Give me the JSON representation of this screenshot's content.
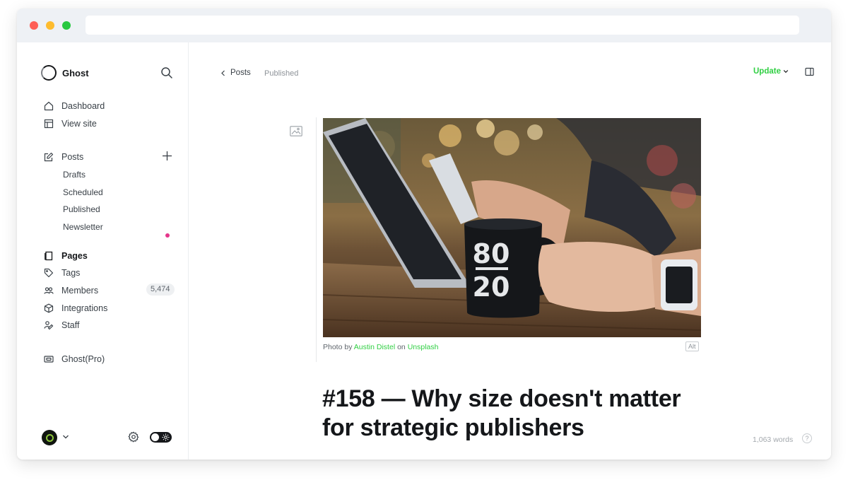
{
  "window": {
    "url": ""
  },
  "sidebar": {
    "brand": "Ghost",
    "nav": [
      {
        "label": "Dashboard",
        "icon": "home-icon"
      },
      {
        "label": "View site",
        "icon": "layout-icon"
      }
    ],
    "posts": {
      "label": "Posts",
      "sub": [
        "Drafts",
        "Scheduled",
        "Published",
        "Newsletter"
      ]
    },
    "nav2": [
      {
        "label": "Pages",
        "icon": "page-icon"
      },
      {
        "label": "Tags",
        "icon": "tag-icon"
      },
      {
        "label": "Members",
        "icon": "members-icon",
        "count": "5,474"
      },
      {
        "label": "Integrations",
        "icon": "box-icon"
      },
      {
        "label": "Staff",
        "icon": "staff-icon"
      }
    ],
    "pro": {
      "label": "Ghost(Pro)",
      "icon": "pro-icon"
    }
  },
  "header": {
    "back_label": "Posts",
    "status": "Published",
    "update_label": "Update"
  },
  "editor": {
    "caption_prefix": "Photo by",
    "caption_author": "Austin Distel",
    "caption_on": "on",
    "caption_source": "Unsplash",
    "alt_label": "Alt",
    "title": "#158 — Why size doesn't matter for strategic publishers",
    "word_count": "1,063 words",
    "help_label": "?"
  },
  "colors": {
    "accent": "#30cf43",
    "newsletter_dot": "#e5368b"
  }
}
